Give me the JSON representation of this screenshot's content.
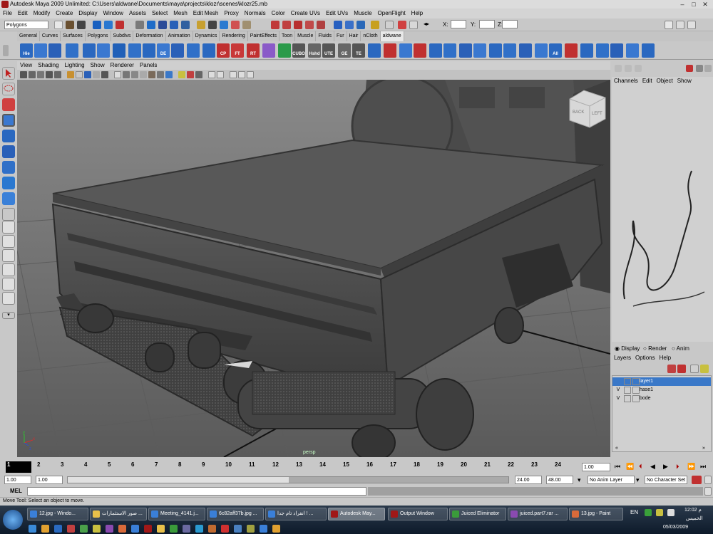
{
  "window": {
    "title": "Autodesk Maya 2009 Unlimited: C:\\Users\\aldwane\\Documents\\maya\\projects\\klozr\\scenes\\klozr25.mb"
  },
  "menubar": [
    "File",
    "Edit",
    "Modify",
    "Create",
    "Display",
    "Window",
    "Assets",
    "Select",
    "Mesh",
    "Edit Mesh",
    "Proxy",
    "Normals",
    "Color",
    "Create UVs",
    "Edit UVs",
    "Muscle",
    "OpenFlight",
    "Help"
  ],
  "statusline": {
    "mode": "Polygons",
    "x_label": "X:",
    "y_label": "Y:",
    "z_label": "Z:"
  },
  "shelf_tabs": [
    "General",
    "Curves",
    "Surfaces",
    "Polygons",
    "Subdivs",
    "Deformation",
    "Animation",
    "Dynamics",
    "Rendering",
    "PaintEffects",
    "Toon",
    "Muscle",
    "Fluids",
    "Fur",
    "Hair",
    "nCloth",
    "aldwane"
  ],
  "shelf_active": "aldwane",
  "shelf_labels": [
    "Hie",
    "DE",
    "CP",
    "FT",
    "RT",
    "CUBO",
    "Hshd",
    "UTE",
    "GE",
    "TE",
    "All"
  ],
  "viewport": {
    "menu": [
      "View",
      "Shading",
      "Lighting",
      "Show",
      "Renderer",
      "Panels"
    ],
    "camera_label": "persp",
    "viewcube_labels": [
      "BACK",
      "LEFT"
    ],
    "axis_labels": [
      "x",
      "y",
      "z"
    ]
  },
  "channel_box": {
    "menu": [
      "Channels",
      "Edit",
      "Object",
      "Show"
    ],
    "watermark": "aldwane"
  },
  "layer_editor": {
    "modes": [
      "Display",
      "Render",
      "Anim"
    ],
    "selected_mode": "Display",
    "menu": [
      "Layers",
      "Options",
      "Help"
    ],
    "layers": [
      {
        "v": "",
        "name": "layer1",
        "selected": true
      },
      {
        "v": "V",
        "name": "hase1",
        "selected": false
      },
      {
        "v": "V",
        "name": "bode",
        "selected": false
      }
    ]
  },
  "time_slider": {
    "ticks": [
      "1",
      "2",
      "3",
      "4",
      "5",
      "6",
      "7",
      "8",
      "9",
      "10",
      "11",
      "12",
      "13",
      "14",
      "15",
      "16",
      "17",
      "18",
      "19",
      "20",
      "21",
      "22",
      "23",
      "24"
    ],
    "current_frame": "1",
    "current_time_field": "1.00"
  },
  "range_slider": {
    "start": "1.00",
    "inner_start": "1.00",
    "inner_end": "24.00",
    "end": "48.00",
    "anim_layer": "No Anim Layer",
    "character_set": "No Character Set"
  },
  "command_line": {
    "label": "MEL",
    "value": ""
  },
  "help_line": "Move Tool: Select an object to move.",
  "taskbar": {
    "tasks": [
      {
        "label": "12.jpg - Windo...",
        "color": "#3a7fd8"
      },
      {
        "label": "صور الاستثمارات ...",
        "color": "#e8c04a"
      },
      {
        "label": "Meeting_4141.j...",
        "color": "#3a7fd8"
      },
      {
        "label": "6c82aff37b.jpg ...",
        "color": "#3a7fd8"
      },
      {
        "label": "انفراد تام جدا ! ...",
        "color": "#3a7fd8"
      },
      {
        "label": "Autodesk May...",
        "color": "#a01818",
        "active": true
      },
      {
        "label": "Output Window",
        "color": "#a01818"
      },
      {
        "label": "Juiced Eliminator",
        "color": "#3a9a3a"
      },
      {
        "label": "juiced.part7.rar ...",
        "color": "#8a4ab0"
      },
      {
        "label": "13.jpg - Paint",
        "color": "#d86a3a"
      }
    ],
    "lang": "EN",
    "time": "12:02 م",
    "day": "الخميس",
    "date": "05/03/2009"
  },
  "colors": {
    "viewport_bg": "#6f6f6f",
    "ui_bg": "#c8c8c8",
    "selection": "#3a78c8"
  }
}
